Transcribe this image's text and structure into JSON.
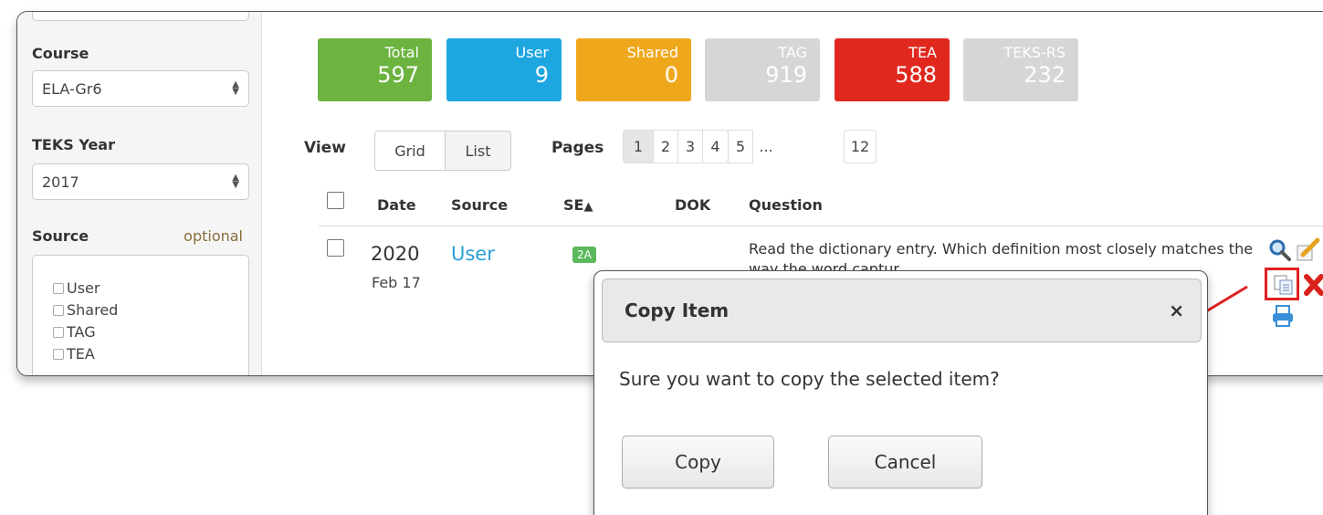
{
  "sidebar": {
    "course_label": "Course",
    "course_value": "ELA-Gr6",
    "teks_year_label": "TEKS Year",
    "teks_year_value": "2017",
    "source_label": "Source",
    "source_optional": "optional",
    "source_options": [
      "User",
      "Shared",
      "TAG",
      "TEA"
    ]
  },
  "tiles": [
    {
      "label": "Total",
      "value": "597",
      "color": "#6cb33f"
    },
    {
      "label": "User",
      "value": "9",
      "color": "#1ea6e0"
    },
    {
      "label": "Shared",
      "value": "0",
      "color": "#efa81c"
    },
    {
      "label": "TAG",
      "value": "919",
      "color": "#d6d6d6"
    },
    {
      "label": "TEA",
      "value": "588",
      "color": "#e0281e"
    },
    {
      "label": "TEKS-RS",
      "value": "232",
      "color": "#d6d6d6"
    }
  ],
  "view": {
    "label": "View",
    "grid": "Grid",
    "list": "List"
  },
  "pages": {
    "label": "Pages",
    "items": [
      "1",
      "2",
      "3",
      "4",
      "5",
      "...",
      "12"
    ],
    "active": "1"
  },
  "table": {
    "headers": {
      "date": "Date",
      "source": "Source",
      "se": "SE",
      "dok": "DOK",
      "question": "Question"
    },
    "sort_icon": "triangle-up-icon",
    "row": {
      "year": "2020",
      "day": "Feb 17",
      "source": "User",
      "se": "2A",
      "question": "Read the dictionary entry. Which definition most closely matches the way the word captur..."
    }
  },
  "row_actions": [
    "search-icon",
    "edit-icon",
    "copy-icon",
    "delete-icon",
    "print-icon"
  ],
  "modal": {
    "title": "Copy Item",
    "close": "×",
    "message": "Sure you want to copy the selected item?",
    "copy_label": "Copy",
    "cancel_label": "Cancel"
  },
  "colors": {
    "link": "#2a9fd6",
    "badge": "#5cb85c",
    "highlight": "#e02020"
  }
}
